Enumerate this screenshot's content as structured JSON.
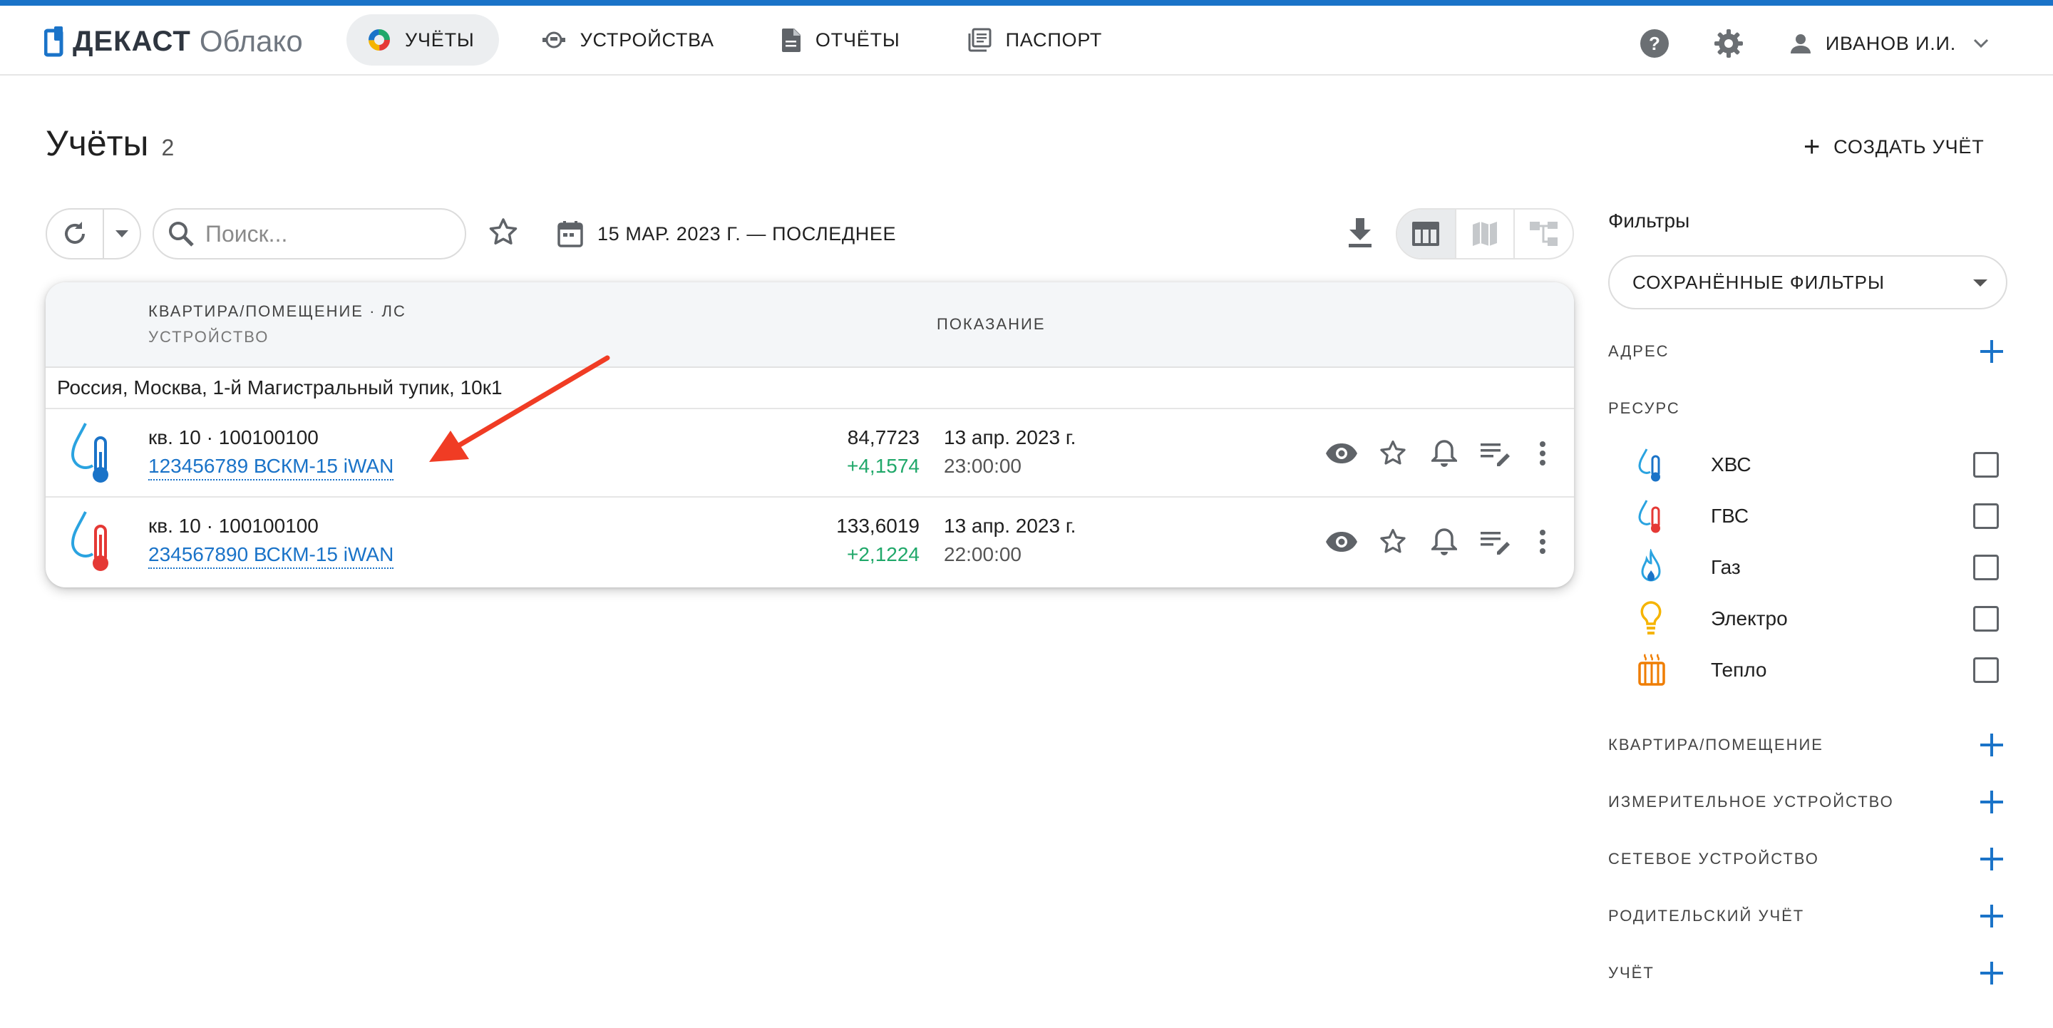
{
  "header": {
    "brand": "ДЕКАСТ",
    "brand_sub": "Облако",
    "nav": [
      {
        "label": "УЧЁТЫ",
        "active": true,
        "icon": "pie-chart-icon"
      },
      {
        "label": "УСТРОЙСТВА",
        "active": false,
        "icon": "meter-icon"
      },
      {
        "label": "ОТЧЁТЫ",
        "active": false,
        "icon": "document-icon"
      },
      {
        "label": "ПАСПОРТ",
        "active": false,
        "icon": "library-icon"
      }
    ],
    "user": "ИВАНОВ И.И."
  },
  "page": {
    "title": "Учёты",
    "count": "2",
    "create_label": "СОЗДАТЬ УЧЁТ"
  },
  "toolbar": {
    "search_placeholder": "Поиск...",
    "date_range": "15 МАР. 2023 Г. — ПОСЛЕДНЕЕ"
  },
  "table": {
    "col_main": "КВАРТИРА/ПОМЕЩЕНИЕ · ЛС",
    "col_main_sub": "УСТРОЙСТВО",
    "col_value": "ПОКАЗАНИЕ",
    "group": "Россия, Москва, 1-й Магистральный тупик, 10к1",
    "rows": [
      {
        "resource": "cold-water",
        "apt": "кв. 10 · 100100100",
        "device": "123456789 ВСКМ-15 iWAN",
        "value": "84,7723",
        "delta": "+4,1574",
        "date": "13 апр. 2023 г.",
        "time": "23:00:00"
      },
      {
        "resource": "hot-water",
        "apt": "кв. 10 · 100100100",
        "device": "234567890 ВСКМ-15 iWAN",
        "value": "133,6019",
        "delta": "+2,1224",
        "date": "13 апр. 2023 г.",
        "time": "22:00:00"
      }
    ]
  },
  "filters": {
    "title": "Фильтры",
    "saved": "СОХРАНЁННЫЕ ФИЛЬТРЫ",
    "address": "АДРЕС",
    "resource": "РЕСУРС",
    "resources": [
      "ХВС",
      "ГВС",
      "Газ",
      "Электро",
      "Тепло"
    ],
    "sections": [
      "КВАРТИРА/ПОМЕЩЕНИЕ",
      "ИЗМЕРИТЕЛЬНОЕ УСТРОЙСТВО",
      "СЕТЕВОЕ УСТРОЙСТВО",
      "РОДИТЕЛЬСКИЙ УЧЁТ",
      "УЧЁТ"
    ]
  },
  "colors": {
    "accent": "#1a73c8",
    "positive": "#20a86a",
    "annotation_arrow": "#f03c24",
    "cold": "#1a73c8",
    "hot": "#e53935",
    "electro": "#f5b400",
    "heat": "#ef7d00"
  }
}
